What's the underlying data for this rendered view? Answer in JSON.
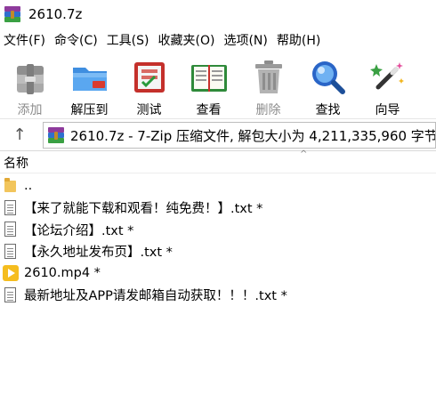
{
  "window": {
    "title": "2610.7z",
    "icon": "winrar-app-icon"
  },
  "menu": [
    "文件(F)",
    "命令(C)",
    "工具(S)",
    "收藏夹(O)",
    "选项(N)",
    "帮助(H)"
  ],
  "toolbar": [
    {
      "label": "添加",
      "icon": "add-archive-icon",
      "enabled": false
    },
    {
      "label": "解压到",
      "icon": "extract-folder-icon",
      "enabled": true
    },
    {
      "label": "测试",
      "icon": "test-archive-icon",
      "enabled": true
    },
    {
      "label": "查看",
      "icon": "view-book-icon",
      "enabled": true
    },
    {
      "label": "删除",
      "icon": "delete-trash-icon",
      "enabled": false
    },
    {
      "label": "查找",
      "icon": "find-magnifier-icon",
      "enabled": true
    },
    {
      "label": "向导",
      "icon": "wizard-wand-icon",
      "enabled": true
    }
  ],
  "address": {
    "up_icon": "up-arrow-icon",
    "text": "2610.7z - 7-Zip 压缩文件, 解包大小为 4,211,335,960 字节"
  },
  "columns": {
    "name": "名称",
    "sort_indicator": "^"
  },
  "files": [
    {
      "name": "..",
      "icon": "folder-up-icon"
    },
    {
      "name": "【来了就能下载和观看！纯免费！】.txt *",
      "icon": "text-file-icon"
    },
    {
      "name": "【论坛介绍】.txt *",
      "icon": "text-file-icon"
    },
    {
      "name": "【永久地址发布页】.txt *",
      "icon": "text-file-icon"
    },
    {
      "name": "2610.mp4 *",
      "icon": "video-file-icon"
    },
    {
      "name": "最新地址及APP请发邮箱自动获取！！！.txt *",
      "icon": "text-file-icon"
    }
  ]
}
